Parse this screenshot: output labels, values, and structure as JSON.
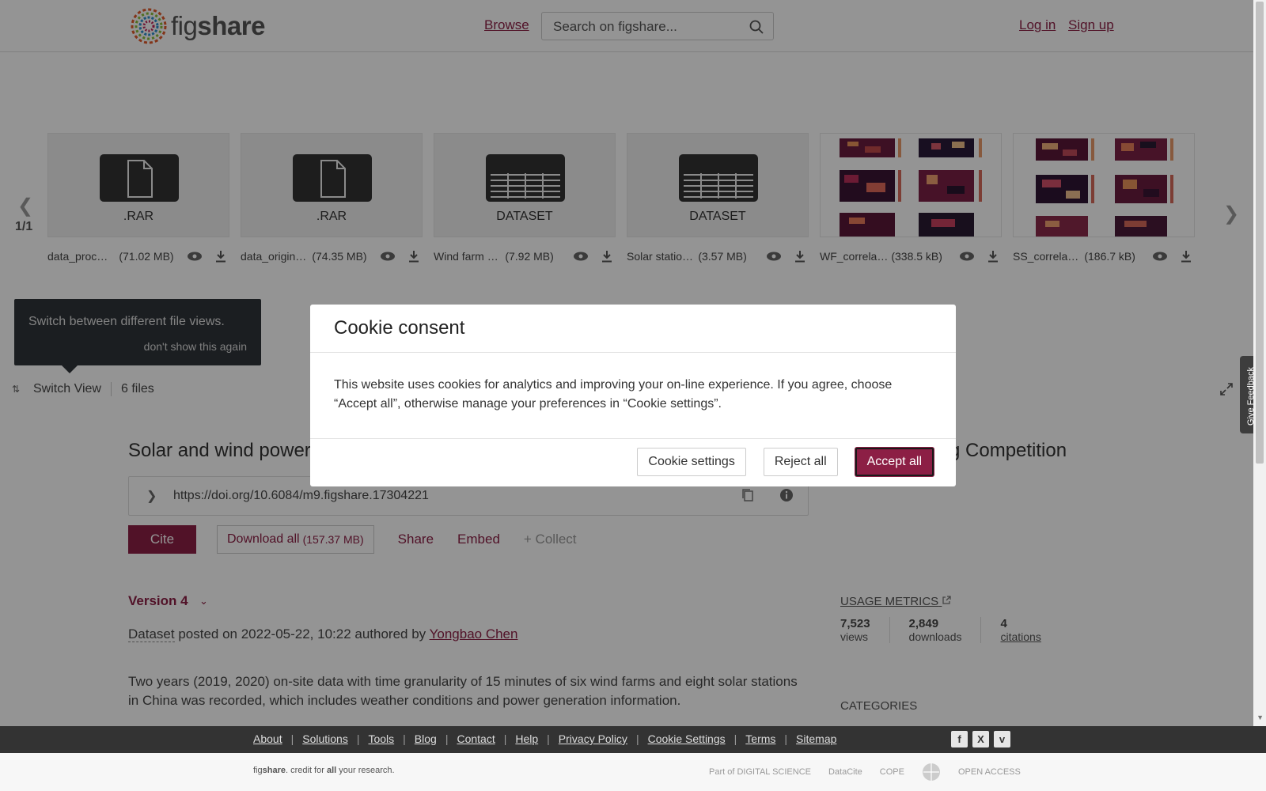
{
  "header": {
    "logo_fig": "fig",
    "logo_share": "share",
    "browse": "Browse",
    "search_placeholder": "Search on figshare...",
    "login": "Log in",
    "signup": "Sign up"
  },
  "carousel": {
    "pager": "1/1",
    "files": [
      {
        "thumb_label": ".RAR",
        "kind": "file-icon",
        "name": "data_proc…",
        "size": "(71.02 MB)"
      },
      {
        "thumb_label": ".RAR",
        "kind": "file-icon",
        "name": "data_origin…",
        "size": "(74.35 MB)"
      },
      {
        "thumb_label": "DATASET",
        "kind": "table-icon",
        "name": "Wind farm s…",
        "size": "(7.92 MB)"
      },
      {
        "thumb_label": "DATASET",
        "kind": "table-icon",
        "name": "Solar statio…",
        "size": "(3.57 MB)"
      },
      {
        "thumb_label": "",
        "kind": "heatmap-image",
        "name": "WF_correla…",
        "size": "(338.5 kB)"
      },
      {
        "thumb_label": "",
        "kind": "heatmap-image",
        "name": "SS_correlat…",
        "size": "(186.7 kB)"
      }
    ],
    "tooltip_text": "Switch between different file views.",
    "tooltip_dismiss": "don't show this again",
    "switch_view": "Switch View",
    "files_count": "6 files"
  },
  "article": {
    "title_left": "Solar and wind power",
    "title_right": "g Competition",
    "doi": "https://doi.org/10.6084/m9.figshare.17304221",
    "cite": "Cite",
    "download_all": "Download all",
    "download_size": "(157.37 MB)",
    "share": "Share",
    "embed": "Embed",
    "collect": "+ Collect",
    "version": "Version 4",
    "posted_type": "Dataset",
    "posted_text": " posted on 2022-05-22, 10:22 authored by ",
    "author": "Yongbao Chen",
    "description": "Two years (2019, 2020) on-site data with time granularity of 15 minutes of six wind farms and eight solar stations in China was recorded, which includes weather conditions and power generation information."
  },
  "metrics": {
    "title": "USAGE METRICS",
    "items": [
      {
        "value": "7,523",
        "label": "views"
      },
      {
        "value": "2,849",
        "label": "downloads"
      },
      {
        "value": "4",
        "label": "citations"
      }
    ],
    "categories_title": "CATEGORIES"
  },
  "cookie": {
    "title": "Cookie consent",
    "body": "This website uses cookies for analytics and improving your on-line experience. If you agree, choose “Accept all”, otherwise manage your preferences in “Cookie settings”.",
    "settings": "Cookie settings",
    "reject": "Reject all",
    "accept": "Accept all"
  },
  "feedback": "Give Feedback",
  "footer": {
    "links": [
      "About",
      "Solutions",
      "Tools",
      "Blog",
      "Contact",
      "Help",
      "Privacy Policy",
      "Cookie Settings",
      "Terms",
      "Sitemap"
    ],
    "social": [
      "facebook-icon",
      "x-icon",
      "vimeo-icon"
    ],
    "tagline_pre": "fig",
    "tagline_brand": "share",
    "tagline_mid": ". credit for ",
    "tagline_all": "all",
    "tagline_post": " your research.",
    "partners": [
      "Part of DIGITAL SCIENCE",
      "DataCite",
      "COPE",
      "",
      "OPEN ACCESS"
    ]
  },
  "colors": {
    "brand": "#8c1f45",
    "overlay": "rgba(0,0,0,0.42)"
  }
}
